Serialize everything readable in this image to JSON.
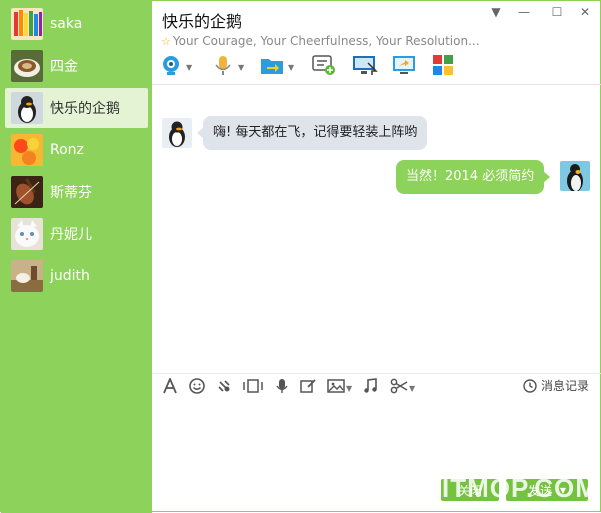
{
  "colors": {
    "sidebar": "#8dd25a",
    "accent_green": "#74c23f",
    "bubble_in": "#dfe3ea",
    "bubble_out": "#8dd25a"
  },
  "sidebar": {
    "contacts": [
      {
        "label": "saka",
        "avatar": "colored-pencils-avatar",
        "active": false
      },
      {
        "label": "四金",
        "avatar": "coffee-cup-avatar",
        "active": false
      },
      {
        "label": "快乐的企鹅",
        "avatar": "penguin-avatar",
        "active": true
      },
      {
        "label": "Ronz",
        "avatar": "flower-avatar",
        "active": false
      },
      {
        "label": "斯蒂芬",
        "avatar": "violin-avatar",
        "active": false
      },
      {
        "label": "丹妮儿",
        "avatar": "white-cat-avatar",
        "active": false
      },
      {
        "label": "judith",
        "avatar": "still-life-avatar",
        "active": false
      }
    ]
  },
  "chat": {
    "title": "快乐的企鹅",
    "status": "Your Courage, Your Cheerfulness, Your Resolution...",
    "toolbar": [
      "video-call-icon",
      "voice-call-icon",
      "file-transfer-icon",
      "create-discussion-icon",
      "remote-assist-icon",
      "screen-share-icon",
      "apps-grid-icon"
    ],
    "messages": [
      {
        "direction": "in",
        "text": "嗨! 每天都在飞，记得要轻装上阵哟"
      },
      {
        "direction": "out",
        "text": "当然！2014 必须简约"
      }
    ]
  },
  "input": {
    "tools": [
      "font-icon",
      "emoji-icon",
      "shake-icon",
      "screenshot-icon",
      "voice-message-icon",
      "edit-icon",
      "image-icon",
      "music-icon",
      "scissors-icon"
    ],
    "history_label": "消息记录",
    "close_label": "关闭",
    "send_label": "发送"
  },
  "watermark": "ITMOP.COM"
}
